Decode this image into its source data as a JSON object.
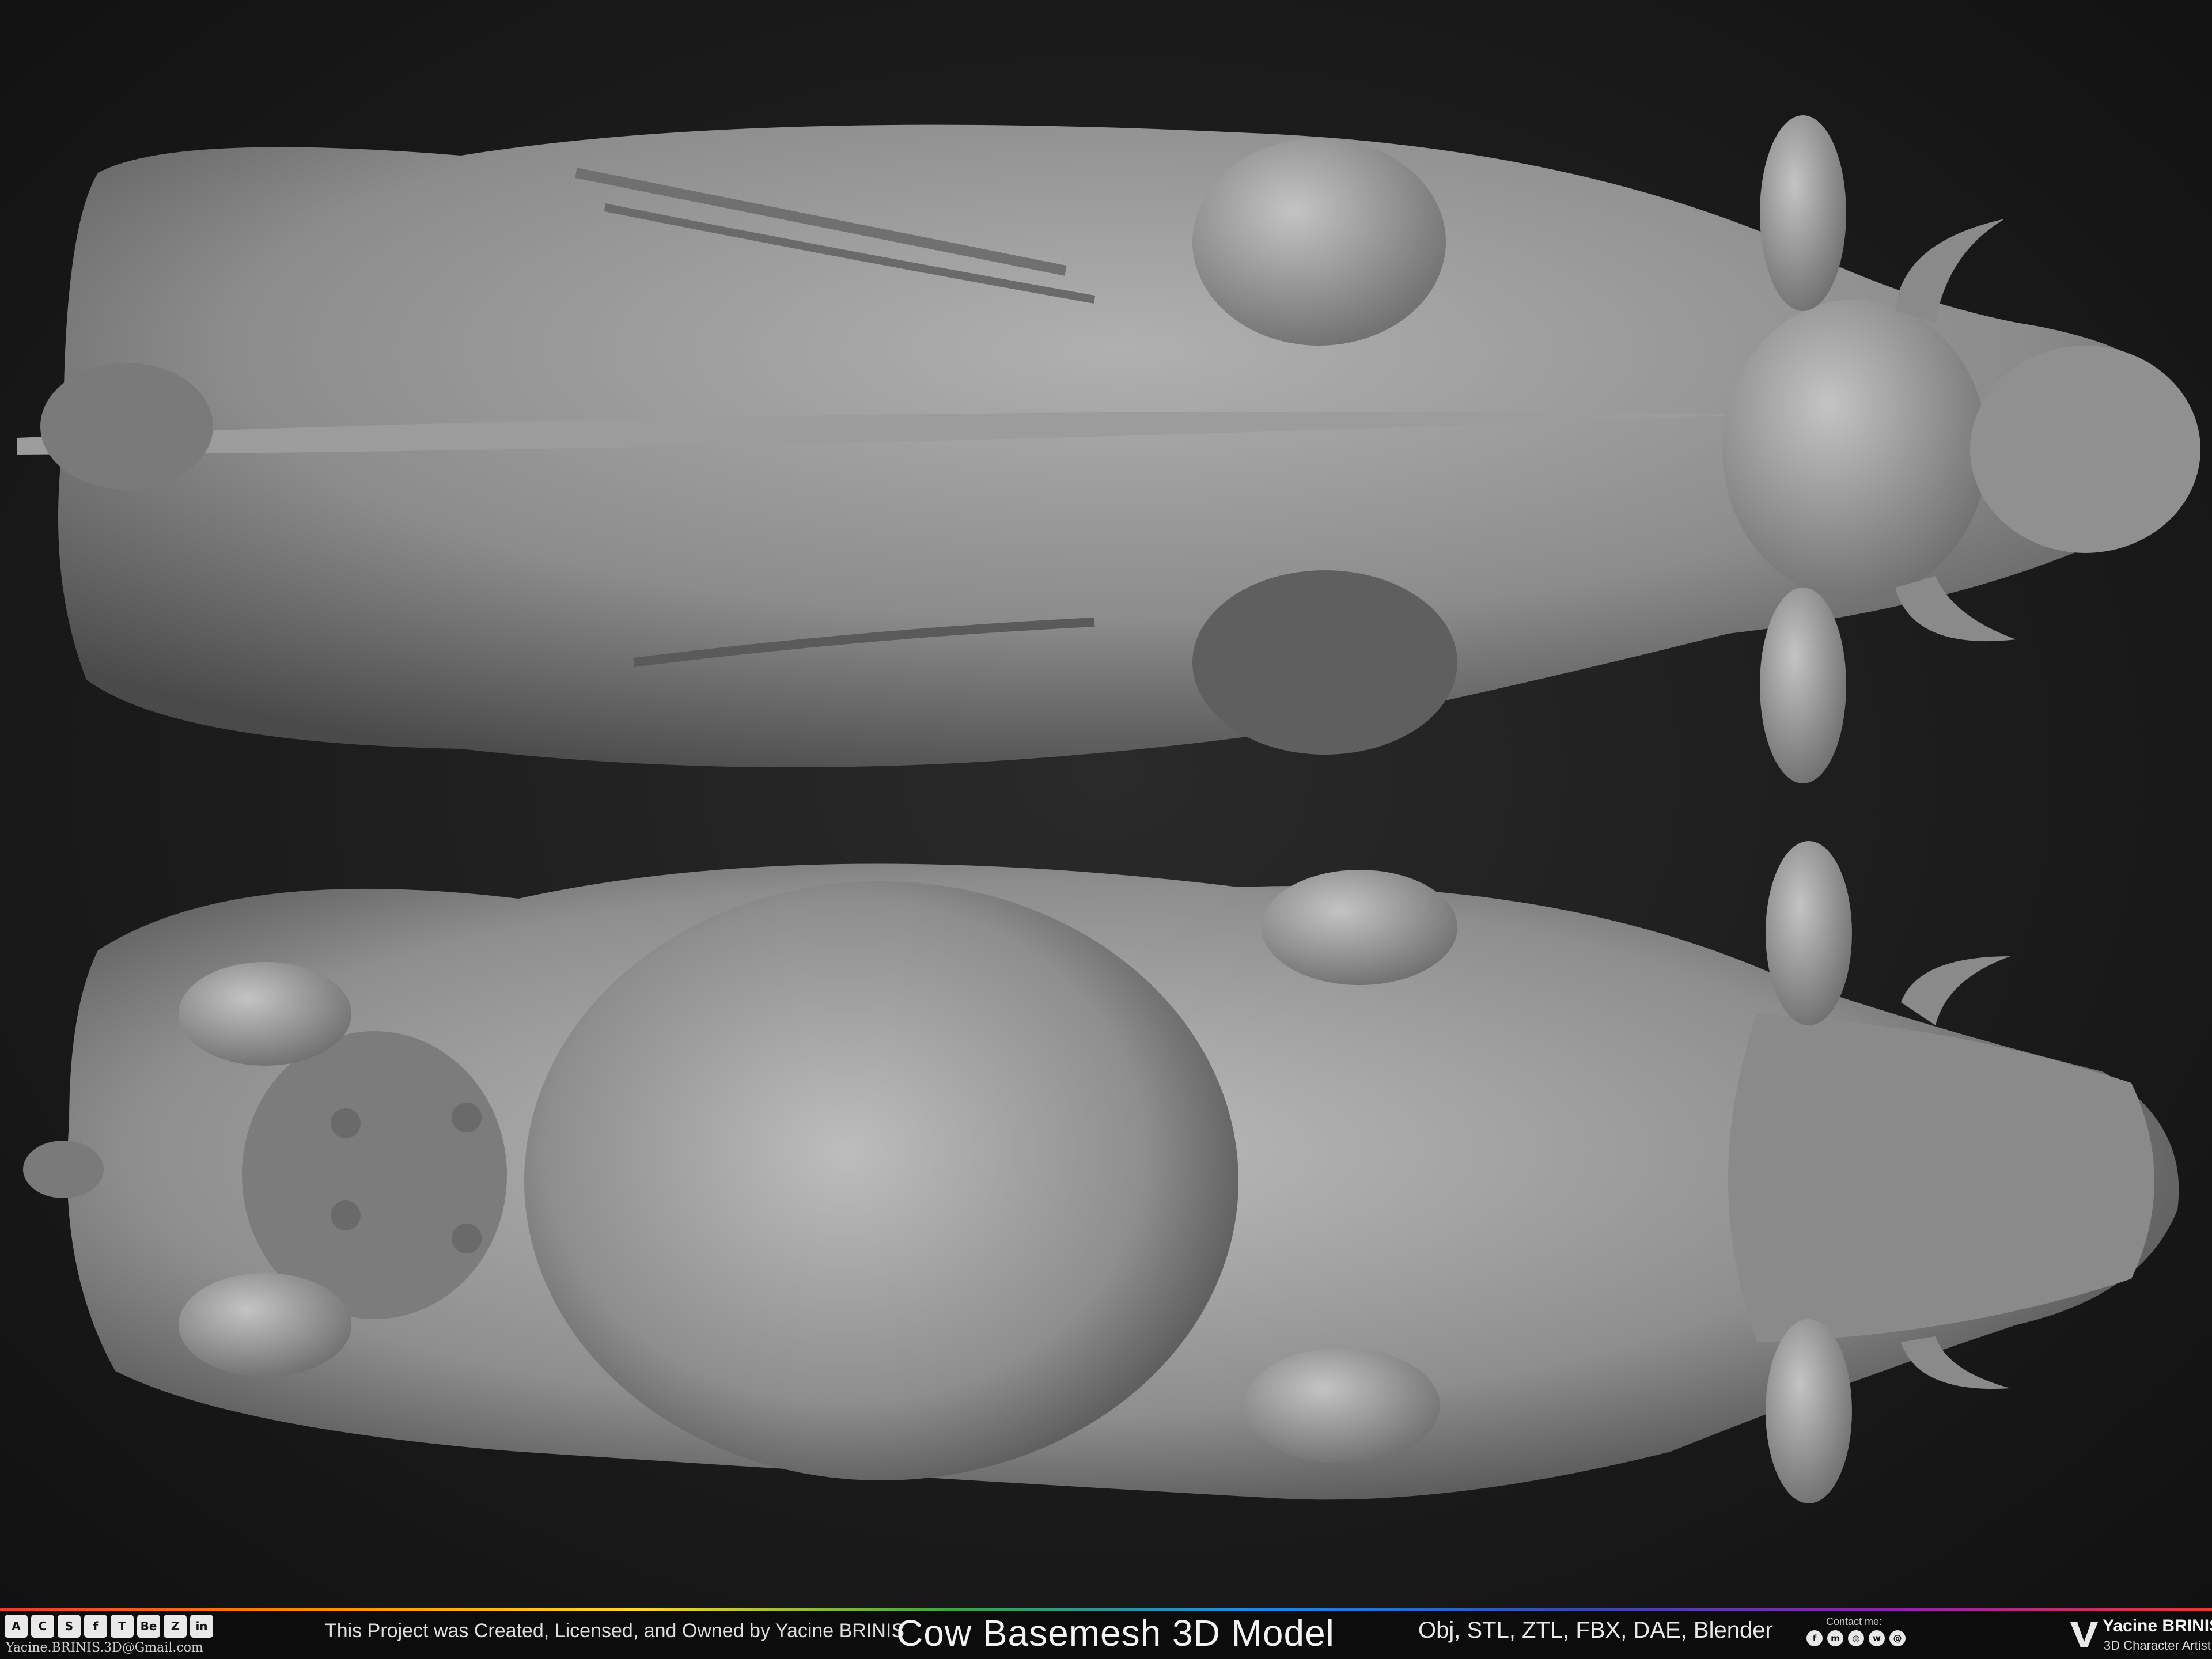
{
  "footer": {
    "social_icons": [
      {
        "icon": "artstation-icon",
        "glyph": "A"
      },
      {
        "icon": "cgtrader-icon",
        "glyph": "C"
      },
      {
        "icon": "sketchfab-icon",
        "glyph": "S"
      },
      {
        "icon": "facebook-icon",
        "glyph": "f"
      },
      {
        "icon": "turbosquid-icon",
        "glyph": "T"
      },
      {
        "icon": "behance-icon",
        "glyph": "Be"
      },
      {
        "icon": "zbrush-icon",
        "glyph": "Z"
      },
      {
        "icon": "linkedin-icon",
        "glyph": "in"
      }
    ],
    "email": "Yacine.BRINIS.3D@Gmail.com",
    "credit": "This Project was Created, Licensed, and Owned by Yacine BRINIS",
    "title": "Cow Basemesh 3D Model",
    "formats": "Obj, STL, ZTL, FBX, DAE, Blender",
    "contact_label": "Contact me:",
    "contact_icons": [
      {
        "icon": "facebook-icon",
        "glyph": "f"
      },
      {
        "icon": "messenger-icon",
        "glyph": "m"
      },
      {
        "icon": "instagram-icon",
        "glyph": "◎"
      },
      {
        "icon": "whatsapp-icon",
        "glyph": "w"
      },
      {
        "icon": "email-icon",
        "glyph": "@"
      }
    ],
    "brand_name": "Yacine BRINIS",
    "brand_role": "3D Character Artist"
  },
  "colors": {
    "background": "#1a1a1a",
    "footer": "#0c0c0c",
    "model_gray": "#8a8a8a"
  }
}
